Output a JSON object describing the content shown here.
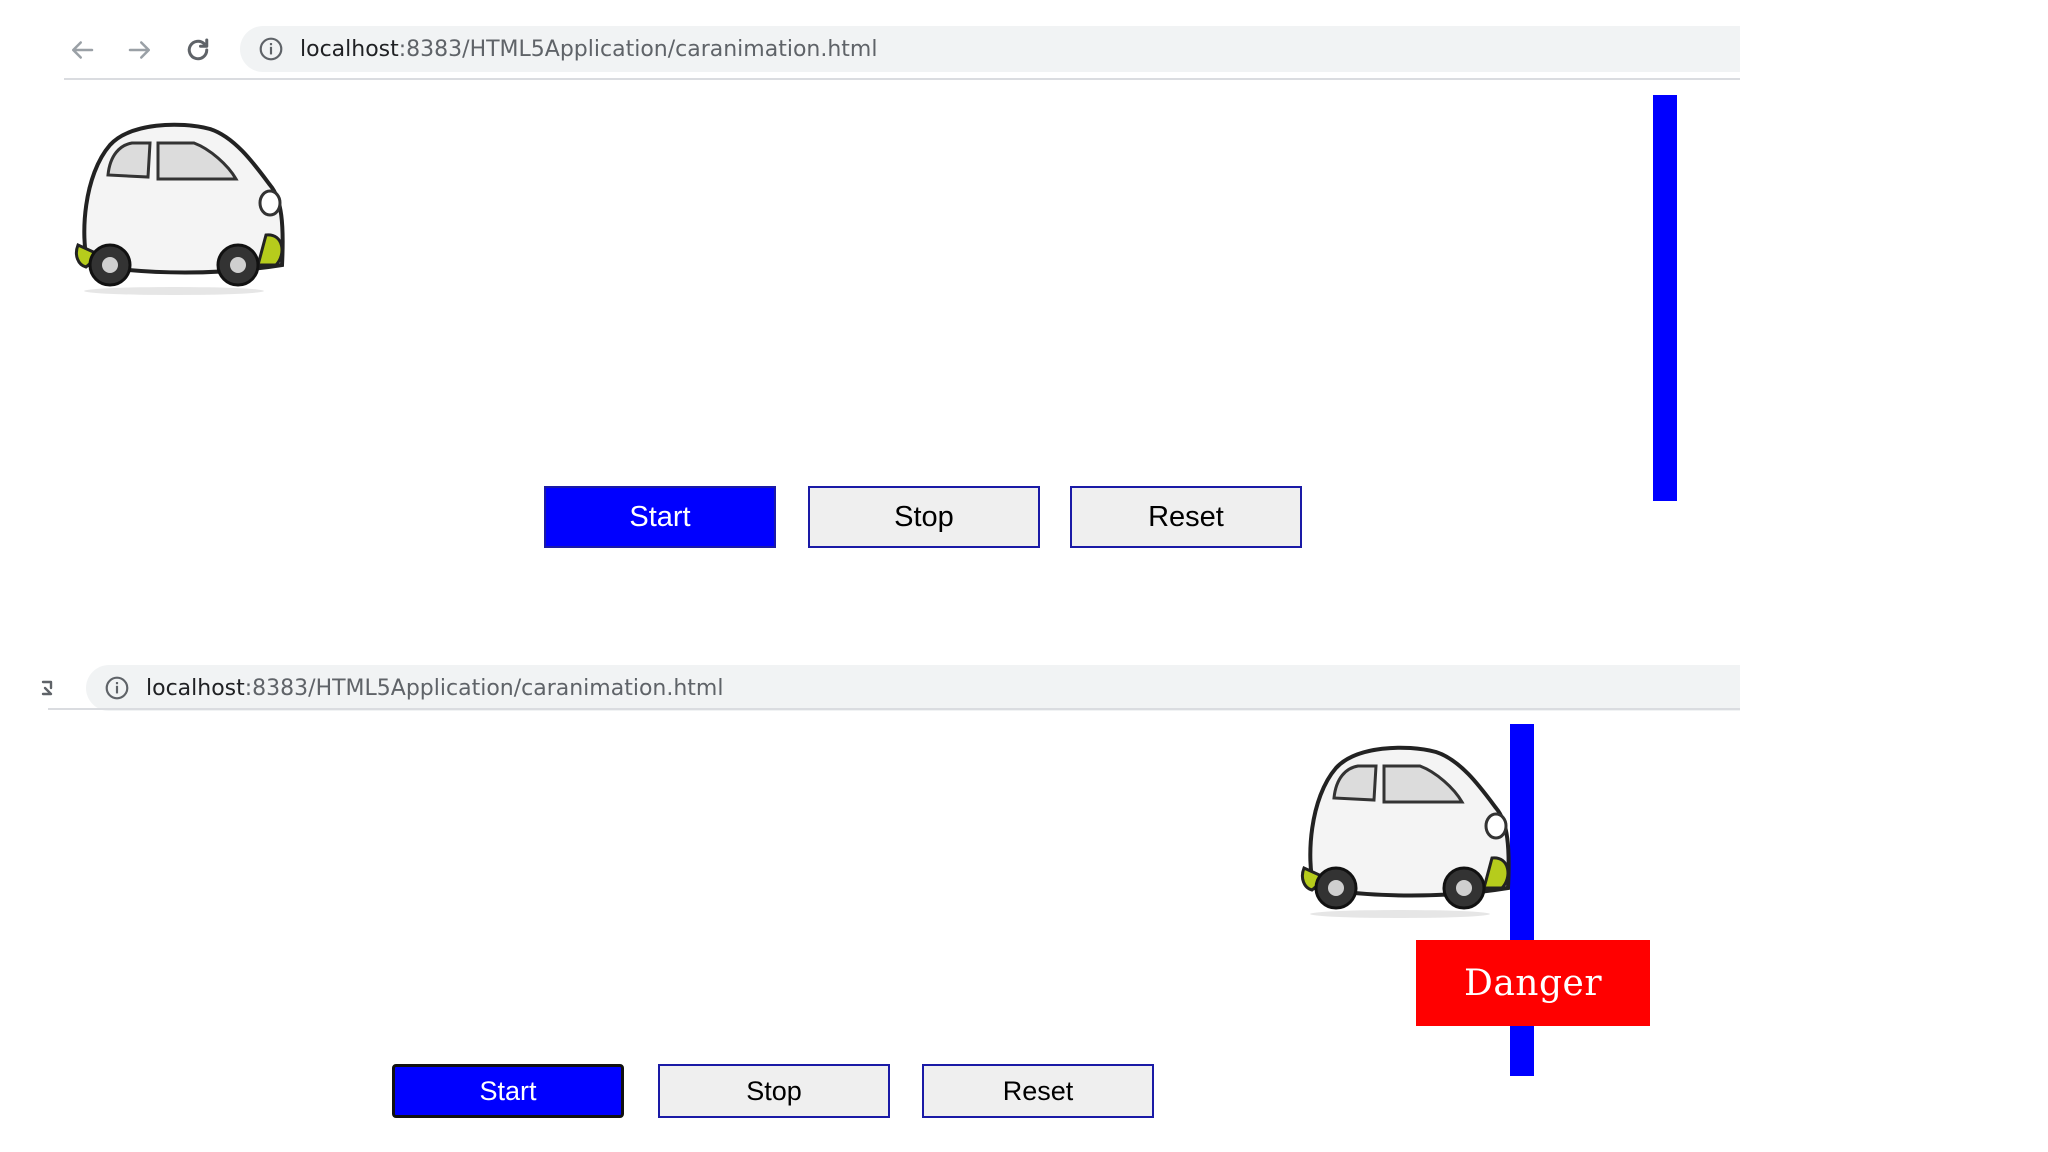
{
  "screens": [
    {
      "url_host": "localhost",
      "url_path": ":8383/HTML5Application/caranimation.html",
      "buttons": {
        "start": "Start",
        "stop": "Stop",
        "reset": "Reset"
      }
    },
    {
      "url_host": "localhost",
      "url_path": ":8383/HTML5Application/caranimation.html",
      "buttons": {
        "start": "Start",
        "stop": "Stop",
        "reset": "Reset"
      },
      "alert": "Danger"
    }
  ],
  "icons": {
    "back": "arrow-left-icon",
    "forward": "arrow-right-icon",
    "reload": "reload-icon",
    "info": "info-icon",
    "car": "car-icon"
  },
  "colors": {
    "wall": "#0000ff",
    "start_button": "#0000ff",
    "danger": "#ff0000",
    "car_accent": "#b6cc1c"
  }
}
